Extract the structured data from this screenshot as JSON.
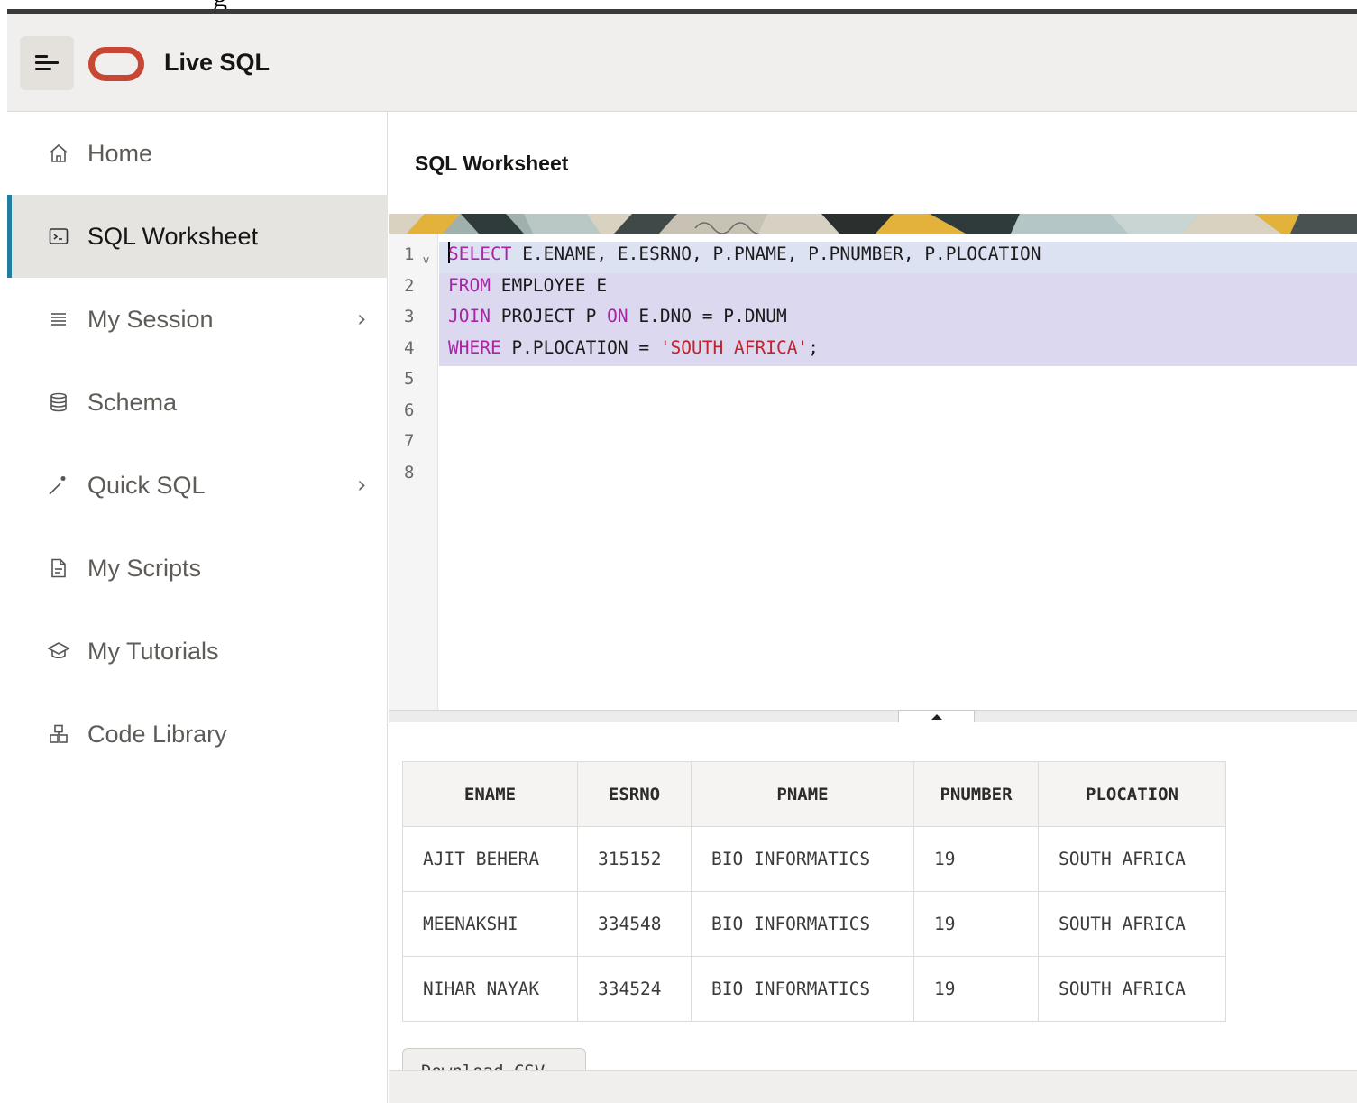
{
  "top": {
    "cut_text": "g"
  },
  "header": {
    "app_title": "Live SQL"
  },
  "sidebar": {
    "items": [
      {
        "label": "Home",
        "icon": "home-icon",
        "active": false,
        "chevron": ""
      },
      {
        "label": "SQL Worksheet",
        "icon": "terminal-icon",
        "active": true,
        "chevron": ""
      },
      {
        "label": "My Session",
        "icon": "list-icon",
        "active": false,
        "chevron": "›"
      },
      {
        "label": "Schema",
        "icon": "database-icon",
        "active": false,
        "chevron": ""
      },
      {
        "label": "Quick SQL",
        "icon": "magic-wand-icon",
        "active": false,
        "chevron": "›"
      },
      {
        "label": "My Scripts",
        "icon": "document-icon",
        "active": false,
        "chevron": ""
      },
      {
        "label": "My Tutorials",
        "icon": "graduation-cap-icon",
        "active": false,
        "chevron": ""
      },
      {
        "label": "Code Library",
        "icon": "library-icon",
        "active": false,
        "chevron": ""
      }
    ]
  },
  "main": {
    "title": "SQL Worksheet",
    "editor": {
      "line_numbers": [
        "1",
        "2",
        "3",
        "4",
        "5",
        "6",
        "7",
        "8"
      ],
      "fold_marker": "v",
      "code": [
        [
          {
            "t": "SELECT",
            "k": "kw"
          },
          {
            "t": " E.ENAME, E.ESRNO, P.PNAME, P.PNUMBER, P.PLOCATION",
            "k": ""
          }
        ],
        [
          {
            "t": "FROM",
            "k": "kw"
          },
          {
            "t": " EMPLOYEE E",
            "k": ""
          }
        ],
        [
          {
            "t": "JOIN",
            "k": "kw"
          },
          {
            "t": " PROJECT P ",
            "k": ""
          },
          {
            "t": "ON",
            "k": "kw"
          },
          {
            "t": " E.DNO = P.DNUM",
            "k": ""
          }
        ],
        [
          {
            "t": "WHERE",
            "k": "kw"
          },
          {
            "t": " P.PLOCATION = ",
            "k": ""
          },
          {
            "t": "'SOUTH AFRICA'",
            "k": "str"
          },
          {
            "t": ";",
            "k": ""
          }
        ]
      ]
    },
    "results": {
      "columns": [
        "ENAME",
        "ESRNO",
        "PNAME",
        "PNUMBER",
        "PLOCATION"
      ],
      "rows": [
        [
          "AJIT BEHERA",
          "315152",
          "BIO INFORMATICS",
          "19",
          "SOUTH AFRICA"
        ],
        [
          "MEENAKSHI",
          "334548",
          "BIO INFORMATICS",
          "19",
          "SOUTH AFRICA"
        ],
        [
          "NIHAR NAYAK",
          "334524",
          "BIO INFORMATICS",
          "19",
          "SOUTH AFRICA"
        ]
      ]
    },
    "download_label": "Download CSV"
  },
  "colors": {
    "accent": "#227e9e",
    "oracle_red": "#c74634",
    "selection": "#dbd8f0",
    "keyword": "#a626a4",
    "string": "#c0232b"
  }
}
